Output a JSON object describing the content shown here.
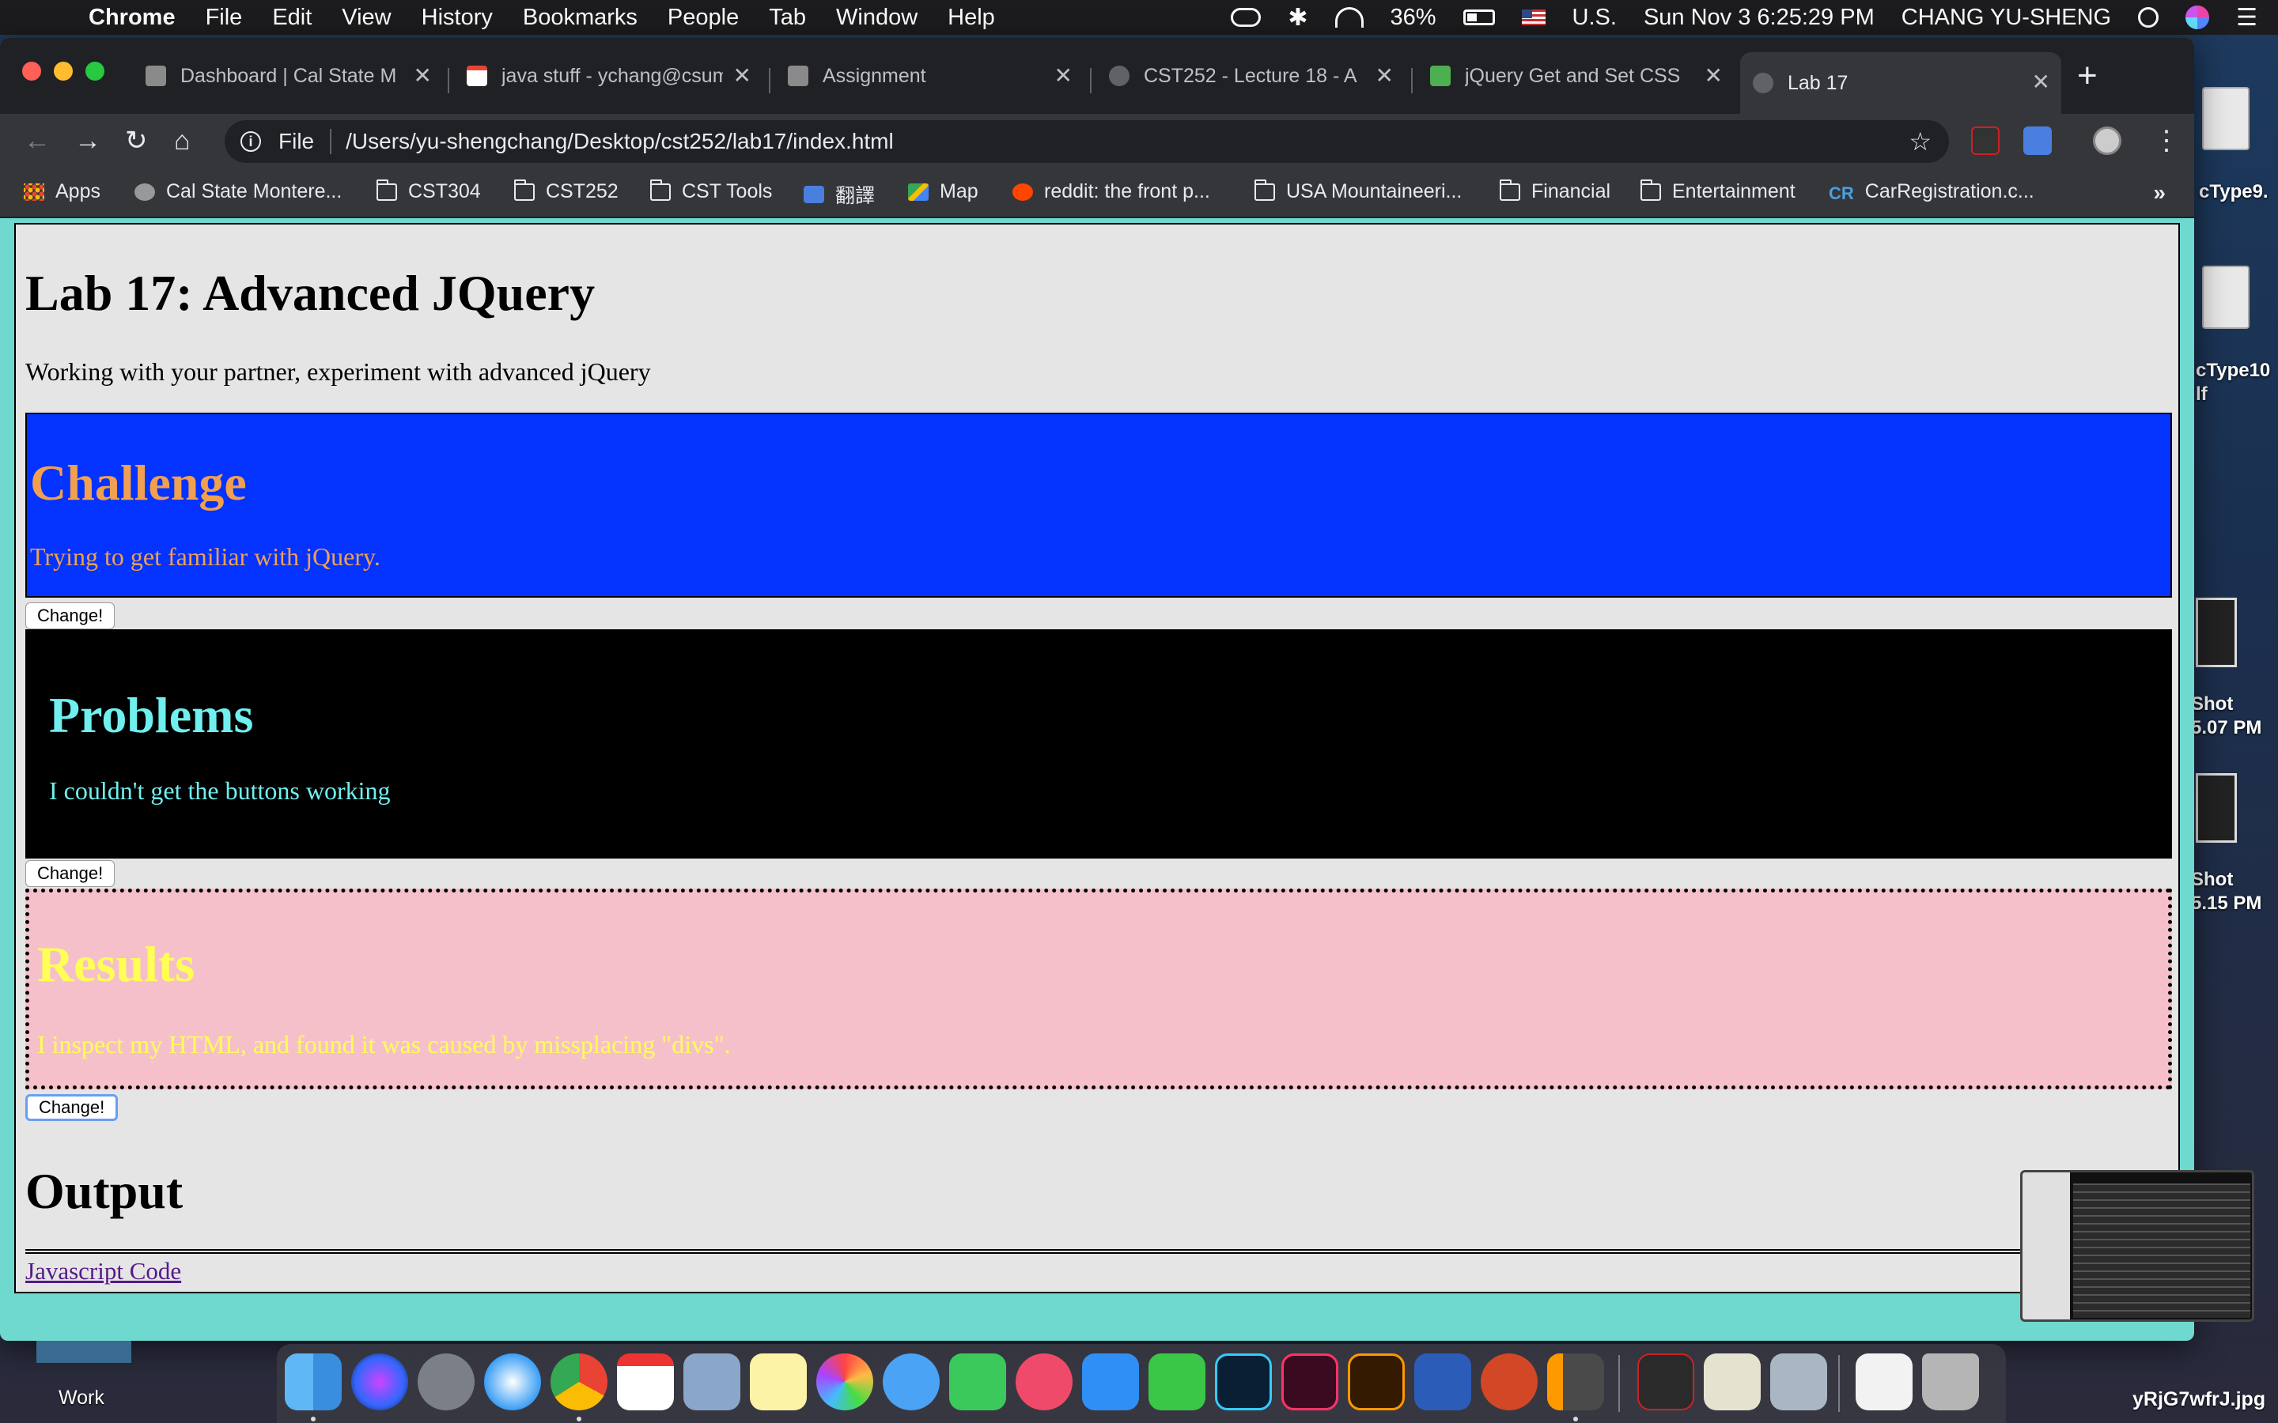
{
  "menubar": {
    "app_name": "Chrome",
    "menus": [
      "File",
      "Edit",
      "View",
      "History",
      "Bookmarks",
      "People",
      "Tab",
      "Window",
      "Help"
    ],
    "battery": "36%",
    "input_source": "U.S.",
    "clock": "Sun Nov 3  6:25:29 PM",
    "user": "CHANG YU-SHENG"
  },
  "desktop": {
    "files": [
      {
        "label": "cType9."
      },
      {
        "label": "cType10\nlf"
      },
      {
        "label": "Shot\n5.07 PM"
      },
      {
        "label": "Shot\n5.15 PM"
      }
    ],
    "bottom_right_file": "yRjG7wfrJ.jpg",
    "work_folder": "Work"
  },
  "browser": {
    "tabs": [
      {
        "title": "Dashboard | Cal State M",
        "favicon": "csumb-icon",
        "active": false
      },
      {
        "title": "java stuff - ychang@csum",
        "favicon": "gmail-icon",
        "active": false
      },
      {
        "title": "Assignment",
        "favicon": "csumb-icon",
        "active": false
      },
      {
        "title": "CST252 - Lecture 18 - A",
        "favicon": "globe-icon",
        "active": false
      },
      {
        "title": "jQuery Get and Set CSS",
        "favicon": "w3schools-icon",
        "active": false
      },
      {
        "title": "Lab 17",
        "favicon": "globe-icon",
        "active": true
      }
    ],
    "address": {
      "scheme": "File",
      "url": "/Users/yu-shengchang/Desktop/cst252/lab17/index.html"
    },
    "bookmarks": [
      {
        "label": "Apps",
        "icon": "apps-grid-icon"
      },
      {
        "label": "Cal State Montere...",
        "icon": "csumb-icon"
      },
      {
        "label": "CST304",
        "icon": "folder-icon"
      },
      {
        "label": "CST252",
        "icon": "folder-icon"
      },
      {
        "label": "CST Tools",
        "icon": "folder-icon"
      },
      {
        "label": "翻譯",
        "icon": "google-translate-icon"
      },
      {
        "label": "Map",
        "icon": "google-maps-icon"
      },
      {
        "label": "reddit: the front p...",
        "icon": "reddit-icon"
      },
      {
        "label": "USA Mountaineeri...",
        "icon": "folder-icon"
      },
      {
        "label": "Financial",
        "icon": "folder-icon"
      },
      {
        "label": "Entertainment",
        "icon": "folder-icon"
      },
      {
        "label": "CarRegistration.c...",
        "icon": "carregistration-icon"
      }
    ],
    "bookmarks_overflow": "»"
  },
  "page": {
    "title": "Lab 17: Advanced JQuery",
    "intro": "Working with your partner, experiment with advanced jQuery",
    "sections": [
      {
        "heading": "Challenge",
        "text": "Trying to get familiar with jQuery.",
        "bg": "#0433ff",
        "fg": "#f0a050"
      },
      {
        "heading": "Problems",
        "text": "I couldn't get the buttons working",
        "bg": "#000000",
        "fg": "#6ff0ef"
      },
      {
        "heading": "Results",
        "text": "I inspect my HTML, and found it was caused by missplacing \"divs\".",
        "bg": "#f6c0cb",
        "fg": "#ffff55"
      }
    ],
    "change_button": "Change!",
    "output_heading": "Output",
    "js_link": "Javascript Code"
  },
  "colors": {
    "window_bg": "#6fd8cf",
    "page_bg": "#e5e5e5",
    "link": "#551a8b"
  }
}
